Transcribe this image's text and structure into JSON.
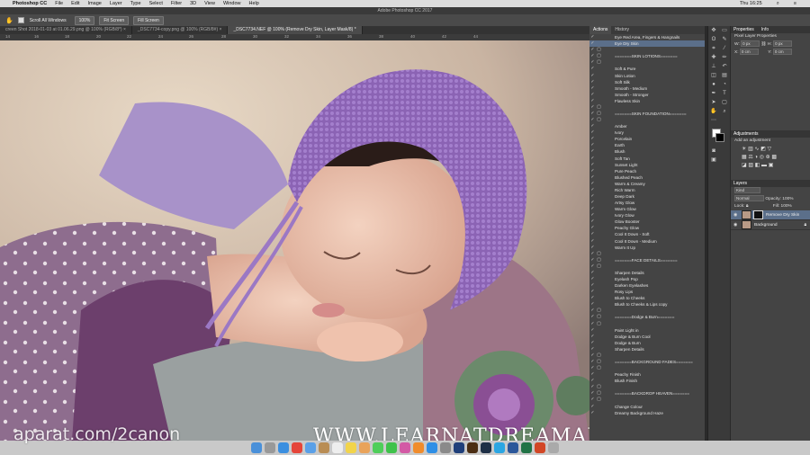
{
  "menubar": {
    "app": "Photoshop CC",
    "items": [
      "File",
      "Edit",
      "Image",
      "Layer",
      "Type",
      "Select",
      "Filter",
      "3D",
      "View",
      "Window",
      "Help"
    ],
    "clock": "Thu 16:25"
  },
  "window": {
    "title": "Adobe Photoshop CC 2017"
  },
  "options": {
    "scroll_all": "Scroll All Windows",
    "zoom": "100%",
    "fit_screen": "Fit Screen",
    "fill_screen": "Fill Screen"
  },
  "tabs": [
    {
      "label": "creen Shot 2018-01-03 at 01.06.29.png @ 100% (RGB/8*) ×"
    },
    {
      "label": "_DSC7734-copy.png @ 100% (RGB/8#) ×"
    },
    {
      "label": "_DSC7734.NEF @ 100% (Remove Dry Skin, Layer Mask/8) *"
    }
  ],
  "ruler": [
    "14",
    "16",
    "18",
    "20",
    "22",
    "24",
    "26",
    "28",
    "30",
    "32",
    "34",
    "36",
    "38",
    "40",
    "42",
    "44"
  ],
  "actions_panel": {
    "tab_actions": "Actions",
    "tab_history": "History",
    "items": [
      "Eye Red Area, Fingers & Hangnails",
      "Eye Dry Skin",
      "",
      "=======SKIN LOTIONS=======",
      "",
      "Soft & Pure",
      "Skin Lotion",
      "Soft Silk",
      "Smooth - Medium",
      "Smooth - Stronger",
      "Flawless Skin",
      "",
      "=======SKIN FOUNDATION=======",
      "",
      "Amber",
      "Ivory",
      "Porcelain",
      "Earth",
      "Blush",
      "Soft Tan",
      "Sunset Light",
      "Pure Peach",
      "Blushed Peach",
      "Warm & Creamy",
      "Rich Warm",
      "Deep Dark",
      "Artsy Glow",
      "Warm Glow",
      "Ivory Glow",
      "Glow Booster",
      "Peachy Glow",
      "Cool It Down - Soft",
      "Cool It Down - Medium",
      "Warm It Up",
      "",
      "=======FACE DETAILS=======",
      "",
      "Sharpen Details",
      "Eyelash Pop",
      "Darken Eyelashes",
      "Rosy Lips",
      "Blush to Cheeks",
      "Blush to Cheeks & Lips copy",
      "",
      "=======Dodge & Burn=======",
      "",
      "Paint Light in",
      "Dodge & Burn Cool",
      "Dodge & Burn",
      "Sharpen Details",
      "",
      "=======BACKGROUND FADES=======",
      "",
      "Peachy Finish",
      "Blush Finish",
      "",
      "=======BACKDROP HEAVEN=======",
      "",
      "Change Colour",
      "Dreamy Background Haze"
    ]
  },
  "properties": {
    "tab_properties": "Properties",
    "tab_info": "Info",
    "title": "Pixel Layer Properties",
    "w_label": "W:",
    "w_value": "0 px",
    "h_label": "H:",
    "h_value": "0 px",
    "x_label": "X:",
    "x_value": "0 cm",
    "y_label": "Y:",
    "y_value": "0 cm"
  },
  "adjustments": {
    "tab": "Adjustments",
    "hint": "Add an adjustment"
  },
  "layers": {
    "tab": "Layers",
    "kind": "Kind",
    "blend": "Normal",
    "opacity_label": "Opacity:",
    "opacity": "100%",
    "lock_label": "Lock:",
    "fill_label": "Fill:",
    "fill": "100%",
    "list": [
      {
        "name": "Remove Dry Skin"
      },
      {
        "name": "Background"
      }
    ]
  },
  "watermarks": {
    "site": "WWW.LEARNATDREAMARTSY.COM",
    "aparat": "aparat.com/2canon"
  },
  "dock": [
    "finder",
    "launchpad",
    "safari",
    "chrome",
    "mail",
    "contacts",
    "calendar",
    "notes",
    "photos",
    "messages",
    "facetime",
    "itunes",
    "ibooks",
    "app-store",
    "system-prefs",
    "photoshop",
    "bridge",
    "lightroom",
    "skype",
    "word",
    "excel",
    "powerpoint",
    "trash"
  ]
}
